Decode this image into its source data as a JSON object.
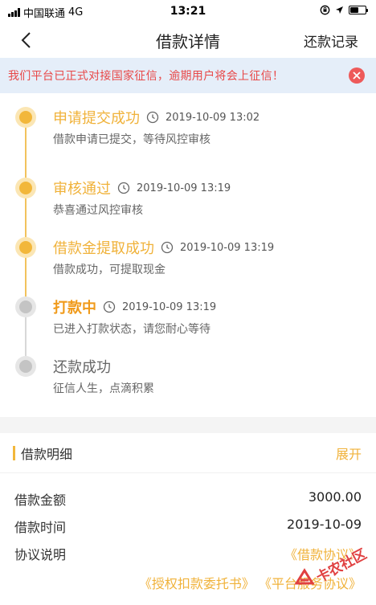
{
  "status_bar": {
    "carrier": "中国联通",
    "network": "4G",
    "time": "13:21"
  },
  "nav": {
    "title": "借款详情",
    "right_action": "还款记录"
  },
  "notice": {
    "text": "我们平台已正式对接国家征信，逾期用户将会上征信！"
  },
  "timeline": {
    "steps": [
      {
        "title": "申请提交成功",
        "time": "2019-10-09 13:02",
        "desc": "借款申请已提交，等待风控审核",
        "state": "done"
      },
      {
        "title": "审核通过",
        "time": "2019-10-09 13:19",
        "desc": "恭喜通过风控审核",
        "state": "done"
      },
      {
        "title": "借款金提取成功",
        "time": "2019-10-09 13:19",
        "desc": "借款成功，可提取现金",
        "state": "done"
      },
      {
        "title": "打款中",
        "time": "2019-10-09 13:19",
        "desc": "已进入打款状态，请您耐心等待",
        "state": "active"
      },
      {
        "title": "还款成功",
        "time": "",
        "desc": "征信人生，点滴积累",
        "state": "pending"
      }
    ]
  },
  "detail": {
    "title": "借款明细",
    "expand_label": "展开",
    "rows": [
      {
        "label": "借款金额",
        "value": "3000.00"
      },
      {
        "label": "借款时间",
        "value": "2019-10-09"
      },
      {
        "label": "协议说明",
        "value": "《借款协议》"
      }
    ],
    "links_line2": [
      "《授权扣款委托书》",
      "《平台服务协议》"
    ]
  },
  "watermark": {
    "text": "卡农社区"
  },
  "colors": {
    "accent": "#f2b73b",
    "active": "#f09a1a",
    "notice_bg": "#e5eef9",
    "notice_text": "#e84848",
    "pending": "#c4c4c4"
  }
}
